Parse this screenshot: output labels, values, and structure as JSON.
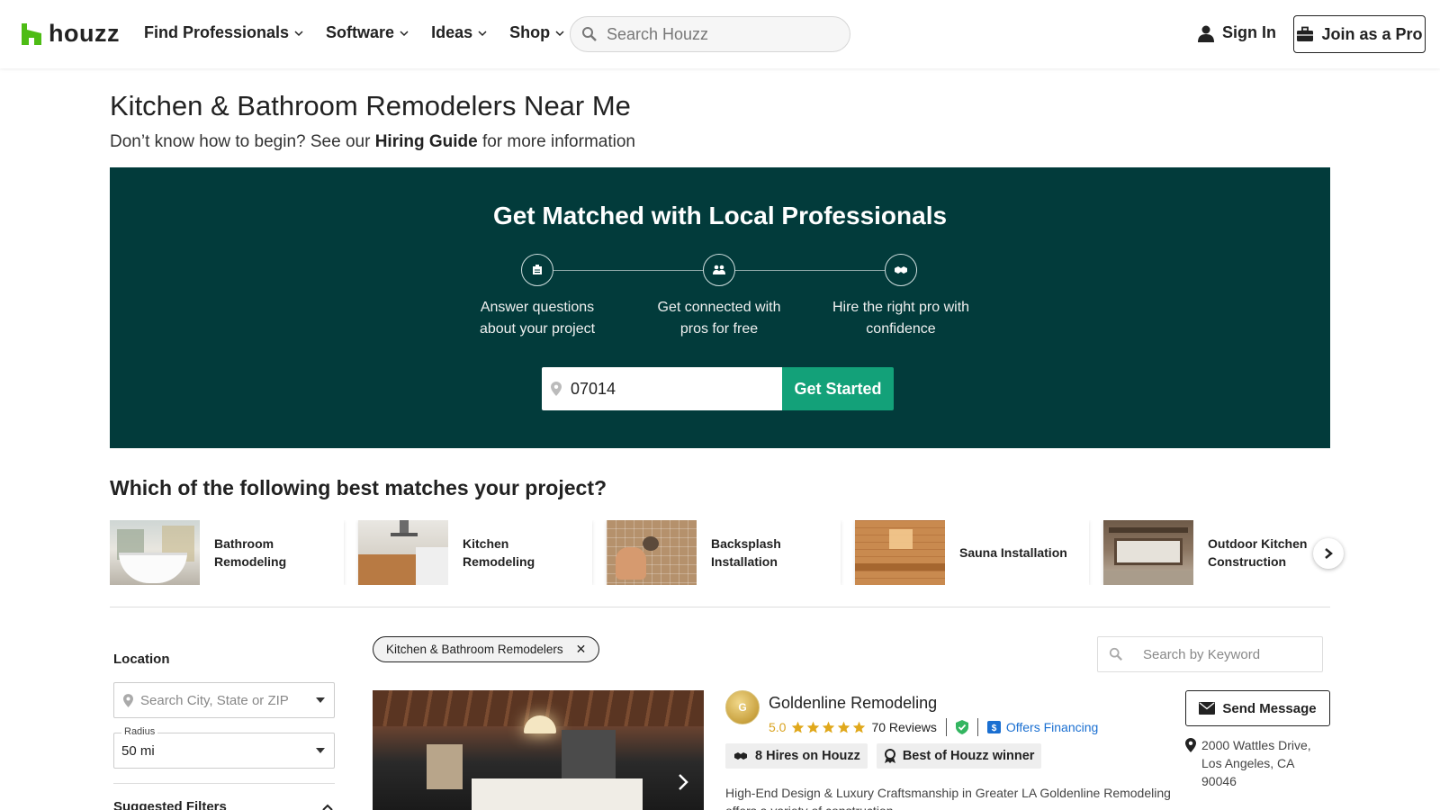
{
  "header": {
    "logo_text": "houzz",
    "nav": [
      {
        "label": "Find Professionals"
      },
      {
        "label": "Software"
      },
      {
        "label": "Ideas"
      },
      {
        "label": "Shop"
      }
    ],
    "search_placeholder": "Search Houzz",
    "sign_in": "Sign In",
    "join_pro": "Join as a Pro"
  },
  "page": {
    "title": "Kitchen & Bathroom Remodelers Near Me",
    "subtitle_pre": "Don’t know how to begin? See our ",
    "subtitle_link": "Hiring Guide",
    "subtitle_post": " for more information"
  },
  "banner": {
    "title": "Get Matched with Local Professionals",
    "steps": [
      {
        "icon": "questionnaire-icon",
        "line1": "Answer questions",
        "line2": "about your project"
      },
      {
        "icon": "people-icon",
        "line1": "Get connected with",
        "line2": "pros for free"
      },
      {
        "icon": "handshake-icon",
        "line1": "Hire the right pro with",
        "line2": "confidence"
      }
    ],
    "zip_value": "07014",
    "cta": "Get Started",
    "bg_color": "#023b3b",
    "cta_color": "#13a179"
  },
  "matching": {
    "title": "Which of the following best matches your project?",
    "cards": [
      {
        "line1": "Bathroom",
        "line2": "Remodeling"
      },
      {
        "line1": "Kitchen",
        "line2": "Remodeling"
      },
      {
        "line1": "Backsplash",
        "line2": "Installation"
      },
      {
        "line1": "Sauna Installation",
        "line2": ""
      },
      {
        "line1": "Outdoor Kitchen",
        "line2": "Construction"
      }
    ]
  },
  "filters": {
    "location_label": "Location",
    "location_placeholder": "Search City, State or ZIP",
    "radius_label": "Radius",
    "radius_value": "50 mi",
    "suggested_label": "Suggested Filters"
  },
  "results": {
    "active_chip": "Kitchen & Bathroom Remodelers",
    "keyword_placeholder": "Search by Keyword",
    "pro": {
      "avatar_letter": "G",
      "name": "Goldenline Remodeling",
      "rating": "5.0",
      "stars": 5,
      "reviews": "70 Reviews",
      "financing": "Offers Financing",
      "badge_hires": "8 Hires on Houzz",
      "badge_best": "Best of Houzz winner",
      "description": "High-End Design & Luxury Craftsmanship in Greater LA Goldenline Remodeling offers a variety of construction",
      "send_message": "Send Message",
      "address_line1": "2000 Wattles Drive,",
      "address_line2": "Los Angeles, CA",
      "address_line3": "90046"
    }
  }
}
